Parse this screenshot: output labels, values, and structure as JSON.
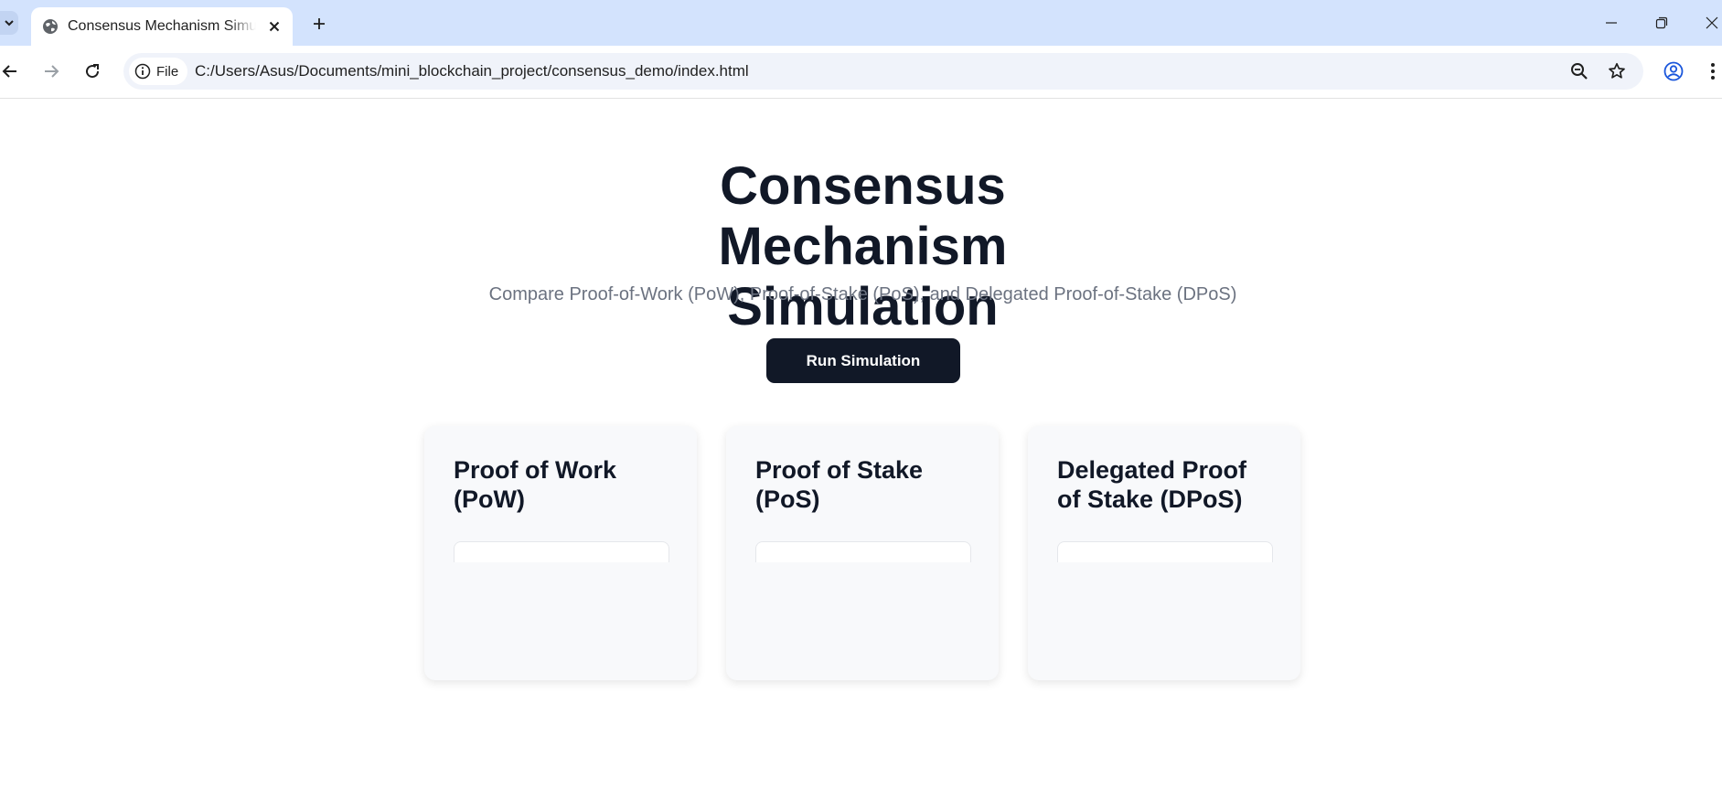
{
  "browser": {
    "tab": {
      "title": "Consensus Mechanism Simulation"
    },
    "address": {
      "chip_label": "File",
      "url": "C:/Users/Asus/Documents/mini_blockchain_project/consensus_demo/index.html"
    },
    "icons": {
      "tab_search": "chevron-down-icon",
      "favicon": "globe-icon",
      "tab_close": "close-icon",
      "new_tab": "plus-icon",
      "back": "arrow-left-icon",
      "forward": "arrow-right-icon",
      "reload": "reload-icon",
      "site_info": "info-icon",
      "zoom": "zoom-out-icon",
      "bookmark": "star-icon",
      "profile": "profile-icon",
      "menu": "kebab-menu-icon"
    }
  },
  "page": {
    "title": "Consensus Mechanism Simulation",
    "subtitle": "Compare Proof-of-Work (PoW), Proof-of-Stake (PoS), and Delegated Proof-of-Stake (DPoS)",
    "run_button": "Run Simulation",
    "cards": [
      {
        "title": "Proof of Work (PoW)"
      },
      {
        "title": "Proof of Stake (PoS)"
      },
      {
        "title": "Delegated Proof of Stake (DPoS)"
      }
    ]
  },
  "colors": {
    "tabstrip": "#d3e3fd",
    "omnibox": "#f0f3fa",
    "heading": "#111827",
    "subtitle": "#6b7280",
    "button": "#111827",
    "card": "#f8f9fb"
  }
}
